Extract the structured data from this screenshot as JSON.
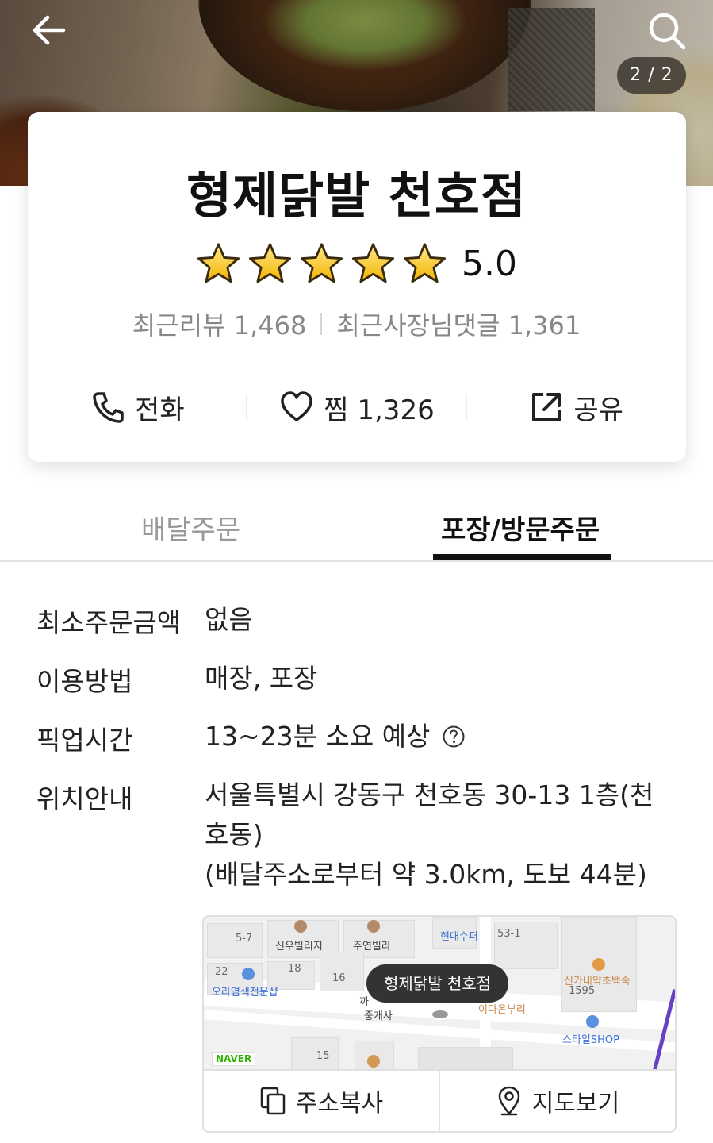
{
  "hero": {
    "image_counter": "2 / 2"
  },
  "store": {
    "name": "형제닭발 천호점",
    "rating": "5.0",
    "stars_filled": 5,
    "recent_reviews": "최근리뷰 1,468",
    "recent_owner_replies": "최근사장님댓글 1,361"
  },
  "actions": {
    "call_label": "전화",
    "favorite_label": "찜 1,326",
    "share_label": "공유"
  },
  "tabs": {
    "delivery": "배달주문",
    "pickup": "포장/방문주문",
    "active": "pickup"
  },
  "info": {
    "min_order_label": "최소주문금액",
    "min_order_value": "없음",
    "usage_label": "이용방법",
    "usage_value": "매장, 포장",
    "pickup_time_label": "픽업시간",
    "pickup_time_value": "13~23분 소요 예상",
    "location_label": "위치안내",
    "address_line1": "서울특별시 강동구 천호동 30-13 1층(천",
    "address_line2": "호동)",
    "distance": "(배달주소로부터 약 3.0km, 도보 44분)"
  },
  "map": {
    "pin_label": "형제닭발 천호점",
    "logo": "NAVER",
    "labels": [
      "5-7",
      "신우빌리지",
      "주연빌라",
      "현대수퍼",
      "53-1",
      "22",
      "18",
      "16",
      "오라염색전문샵",
      "까",
      "중개사",
      "이다온부리",
      "신가네약초백숙",
      "1595",
      "스타일SHOP",
      "15"
    ],
    "colors": {
      "pin_bg": "#333333",
      "route": "#6a3fc8"
    }
  },
  "map_buttons": {
    "copy_address": "주소복사",
    "view_map": "지도보기"
  },
  "icons": {
    "back": "back-arrow-icon",
    "search": "search-icon",
    "star": "star-icon",
    "phone": "phone-icon",
    "heart": "heart-icon",
    "share": "share-icon",
    "help": "help-icon",
    "copy": "copy-icon",
    "location": "location-pin-icon"
  }
}
